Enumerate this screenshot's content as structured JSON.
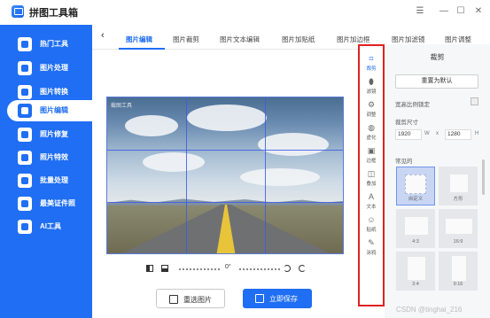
{
  "app": {
    "title": "拼图工具箱"
  },
  "window_controls": {
    "menu": "☰",
    "minimize": "—",
    "maximize": "☐",
    "close": "✕"
  },
  "sidebar": {
    "items": [
      {
        "label": "热门工具",
        "icon": "fire-icon"
      },
      {
        "label": "图片处理",
        "icon": "image-icon"
      },
      {
        "label": "图片转换",
        "icon": "convert-icon"
      },
      {
        "label": "图片编辑",
        "icon": "edit-image-icon",
        "active": true
      },
      {
        "label": "照片修复",
        "icon": "repair-icon"
      },
      {
        "label": "照片特效",
        "icon": "effects-icon"
      },
      {
        "label": "批量处理",
        "icon": "batch-icon"
      },
      {
        "label": "最美证件照",
        "icon": "id-photo-icon"
      },
      {
        "label": "AI工具",
        "icon": "ai-icon"
      }
    ]
  },
  "tabs": {
    "back": "‹",
    "items": [
      "图片编辑",
      "图片裁剪",
      "图片文本编辑",
      "图片加贴纸",
      "图片加边框",
      "图片加滤镜",
      "图片调整"
    ],
    "active_index": 0
  },
  "canvas": {
    "watermark": "截图工具",
    "angle": "0°"
  },
  "buttons": {
    "reselect": "重选图片",
    "save": "立即保存"
  },
  "rail": {
    "items": [
      {
        "label": "裁剪",
        "icon": "crop-icon",
        "glyph": "⌗",
        "active": true
      },
      {
        "label": "滤镜",
        "icon": "filter-icon",
        "glyph": "⬮"
      },
      {
        "label": "调整",
        "icon": "adjust-icon",
        "glyph": "⚙"
      },
      {
        "label": "虚化",
        "icon": "blur-icon",
        "glyph": "◍"
      },
      {
        "label": "边框",
        "icon": "frame-icon",
        "glyph": "▣"
      },
      {
        "label": "叠加",
        "icon": "overlay-icon",
        "glyph": "◫"
      },
      {
        "label": "文本",
        "icon": "text-icon",
        "glyph": "A"
      },
      {
        "label": "贴纸",
        "icon": "sticker-icon",
        "glyph": "☺"
      },
      {
        "label": "涂鸦",
        "icon": "doodle-icon",
        "glyph": "✎"
      }
    ]
  },
  "panel": {
    "title": "裁剪",
    "reset": "重置为默认",
    "lock_ratio": "宽高比例锁定",
    "size_label": "裁剪尺寸",
    "width_value": "1920",
    "width_unit": "W",
    "times": "x",
    "height_value": "1280",
    "height_unit": "H",
    "common_label": "常见的",
    "presets": [
      {
        "label": "自定义",
        "active": true
      },
      {
        "label": "方形"
      },
      {
        "label": "4:3"
      },
      {
        "label": "16:9"
      },
      {
        "label": "3:4"
      },
      {
        "label": "9:16"
      }
    ]
  },
  "footer": {
    "watermark": "CSDN @tinghai_216"
  },
  "colors": {
    "accent": "#1f6ef3",
    "highlight": "#e02020"
  }
}
